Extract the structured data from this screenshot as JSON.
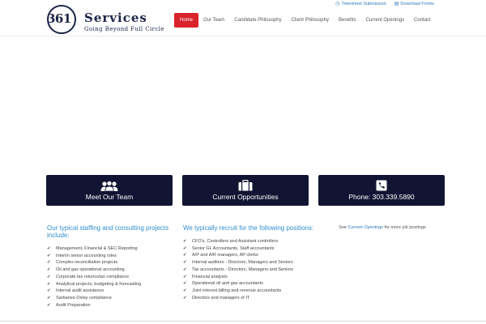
{
  "logo": {
    "number": "361",
    "word": "Services",
    "tagline": "Going Beyond Full Circle"
  },
  "utility": {
    "timesheet": "Timesheet Submission",
    "download": "Download Forms"
  },
  "nav": {
    "items": [
      "Home",
      "Our Team",
      "Candidate Philosophy",
      "Client Philosophy",
      "Benefits",
      "Current Openings",
      "Contact"
    ],
    "active_color": "#d8232a"
  },
  "tiles": [
    {
      "label": "Meet Our Team",
      "icon": "users-icon"
    },
    {
      "label": "Current Opportunities",
      "icon": "briefcase-icon"
    },
    {
      "label": "Phone: 303.339.5890",
      "icon": "phone-icon"
    }
  ],
  "staffing": {
    "heading": "Our typical staffing and consulting projects include:",
    "items": [
      "Management, Financial & SEC Reporting",
      "Interim senior accounting roles",
      "Complex reconciliation projects",
      "Oil and gas operational accounting",
      "Corporate tax returns/tax compliance",
      "Analytical projects, budgeting & forecasting",
      "Internal audit assistance",
      "Sarbanes-Oxley compliance",
      "Audit Preparation"
    ]
  },
  "recruit": {
    "heading": "We typically recruit for the following positions:",
    "items": [
      "CFO's, Controllers and Assistant controllers",
      "Senior GL Accountants, Staff accountants",
      "A/P and A/R managers, AP clerks",
      "Internal auditors - Directors, Managers and Seniors",
      "Tax accountants - Directors, Managers and Seniors",
      "Financial analysts",
      "Operational oil and gas accountants",
      "Joint interest billing and revenue accountants",
      "Directors and managers of IT"
    ]
  },
  "see_more": {
    "prefix": "See",
    "link": "Current Openings",
    "suffix": "for more job postings"
  },
  "colors": {
    "brand_navy": "#1c2447",
    "tile_bg": "#111533",
    "heading_blue": "#2f8ecf",
    "link_blue": "#2a7ab8"
  }
}
